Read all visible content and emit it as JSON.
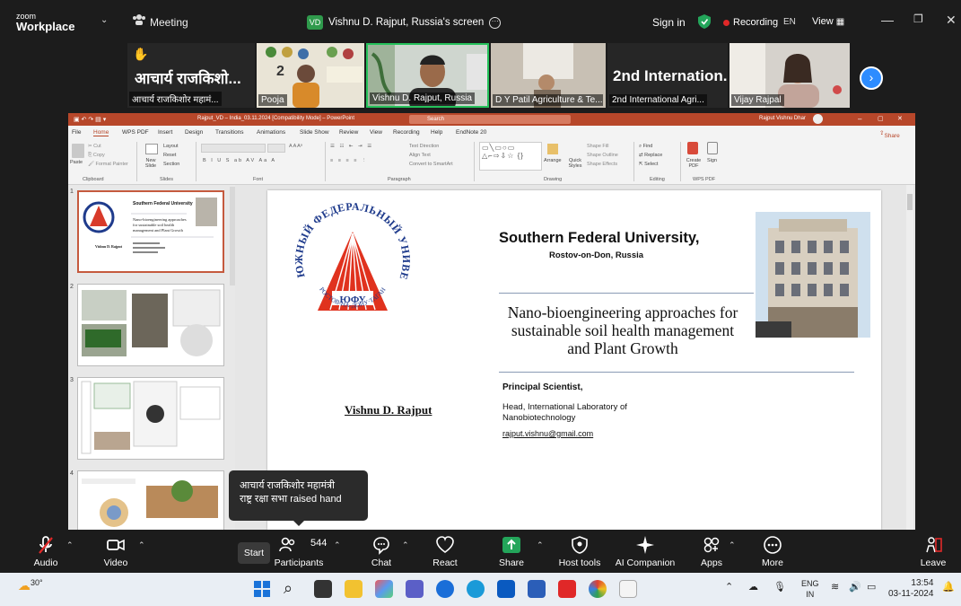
{
  "topbar": {
    "brand_small": "zoom",
    "brand_big": "Workplace",
    "meeting_label": "Meeting",
    "screen_badge": "VD",
    "screen_share_label": "Vishnu D. Rajput, Russia's screen",
    "sign_in": "Sign in",
    "recording": "Recording",
    "lang": "EN",
    "view": "View"
  },
  "participants": [
    {
      "big_text": "आचार्य राजकिशो...",
      "name": "आचार्य राजकिशोर महामं..."
    },
    {
      "name": "Pooja"
    },
    {
      "name": "Vishnu D. Rajput, Russia"
    },
    {
      "name": "D Y Patil Agriculture & Te..."
    },
    {
      "big_text": "2nd  Internation...",
      "name": "2nd International Agri..."
    },
    {
      "name": "Vijay Rajpal"
    }
  ],
  "ppt": {
    "title": "Rajput_VD – India_03.11.2024 [Compatibility Mode] – PowerPoint",
    "search": "Search",
    "user": "Rajput Vishnu Dhar",
    "tabs": [
      "File",
      "Home",
      "WPS PDF",
      "Insert",
      "Design",
      "Transitions",
      "Animations",
      "Slide Show",
      "Review",
      "View",
      "Recording",
      "Help",
      "EndNote 20"
    ],
    "share": "Share",
    "groups": [
      "Clipboard",
      "Slides",
      "Font",
      "Paragraph",
      "Drawing",
      "Editing",
      "WPS PDF"
    ],
    "ribbon": {
      "paste": "Paste",
      "new_slide": "New Slide",
      "layout": "Layout",
      "reset": "Reset",
      "section": "Section",
      "arrange": "Arrange",
      "quick_styles": "Quick Styles",
      "find": "Find",
      "replace": "Replace",
      "select": "Select",
      "create_pdf": "Create PDF",
      "sign": "Sign"
    },
    "thumb_numbers": [
      "1",
      "2",
      "3",
      "4"
    ],
    "thumb1_title": "Southern Federal University",
    "thumb1_text": "Nano-bioengineering approaches for sustainable soil health management and Plant Growth",
    "thumb1_author": "Vishnu D. Rajput"
  },
  "slide": {
    "university": "Southern Federal University,",
    "city": "Rostov-on-Don, Russia",
    "title": "Nano-bioengineering approaches for sustainable soil health management and Plant Growth",
    "author": "Vishnu D. Rajput",
    "position": "Principal Scientist,",
    "head": "Head, International Laboratory of Nanobiotechnology",
    "email": "rajput.vishnu@gmail.com",
    "logo_text": "ЮЖНЫЙ ФЕДЕРАЛЬНЫЙ УНИВЕРСИТЕТ",
    "logo_sub": "РОСТОВ-НА-ДОНУ·ТАГАНРОГ",
    "logo_abbr": "ЮФУ"
  },
  "tooltip": {
    "line1": "आचार्य राजकिशोर महामंत्री",
    "line2": "राष्ट्र रक्षा सभा raised hand"
  },
  "controls": {
    "audio": "Audio",
    "video": "Video",
    "start": "Start",
    "participants": "Participants",
    "participant_count": "544",
    "chat": "Chat",
    "react": "React",
    "share": "Share",
    "host_tools": "Host tools",
    "ai_companion": "AI Companion",
    "apps": "Apps",
    "more": "More",
    "leave": "Leave"
  },
  "taskbar": {
    "temp": "30°",
    "lang_top": "ENG",
    "lang_bottom": "IN",
    "time": "13:54",
    "date": "03-11-2024"
  },
  "colors": {
    "zoom_blue": "#2d8cff",
    "ppt_red": "#b7472a",
    "share_green": "#23a55a",
    "record_red": "#e02828"
  }
}
